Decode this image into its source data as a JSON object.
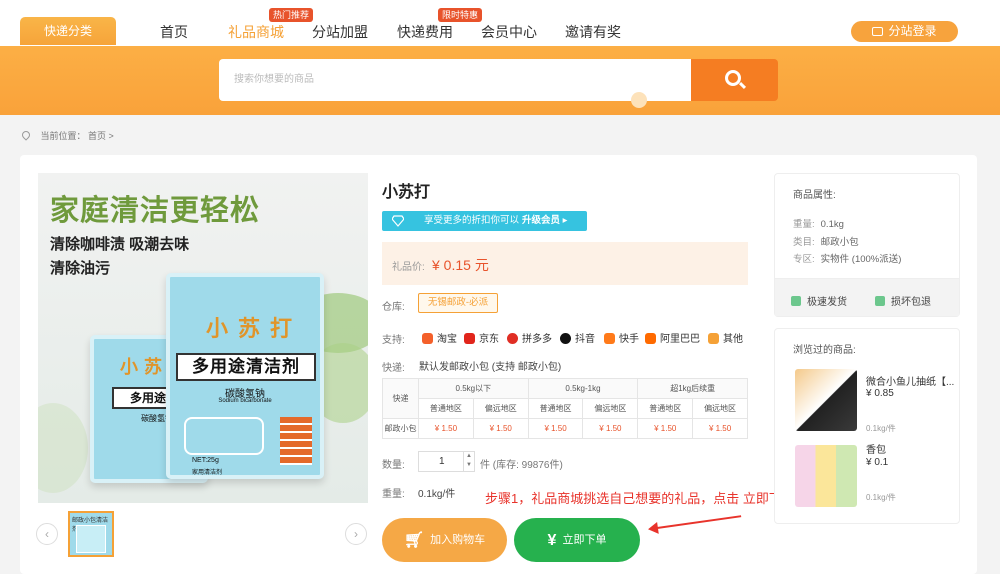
{
  "nav": {
    "category_button": "快递分类",
    "links": [
      "首页",
      "礼品商城",
      "分站加盟",
      "快递费用",
      "会员中心",
      "邀请有奖"
    ],
    "badge_hot": "热门推荐",
    "badge_sale": "限时特惠",
    "login_label": "分站登录"
  },
  "search": {
    "placeholder": "搜索你想要的商品"
  },
  "breadcrumb": {
    "label": "当前位置：",
    "path": "首页 >"
  },
  "product": {
    "title": "小苏打",
    "vip_message": "享受更多的折扣你可以",
    "vip_upgrade": "升级会员 ▸",
    "price_label": "礼品价:",
    "price": "¥ 0.15 元",
    "warehouse_label": "仓库:",
    "warehouse_value": "无锡邮政-必派",
    "support_label": "支持:",
    "platforms": [
      "淘宝",
      "京东",
      "拼多多",
      "抖音",
      "快手",
      "阿里巴巴",
      "其他"
    ],
    "shipping_label": "快递:",
    "shipping_text": "默认发邮政小包 (支持 邮政小包)",
    "table": {
      "corner": "快递",
      "groups": [
        "0.5kg以下",
        "0.5kg-1kg",
        "超1kg后续重"
      ],
      "subheads": [
        "普通地区",
        "偏远地区",
        "普通地区",
        "偏远地区",
        "普通地区",
        "偏远地区"
      ],
      "row_name": "邮政小包",
      "row_values": [
        "¥ 1.50",
        "¥ 1.50",
        "¥ 1.50",
        "¥ 1.50",
        "¥ 1.50",
        "¥ 1.50"
      ]
    },
    "qty_label": "数量:",
    "qty_value": "1",
    "stock_text": "件 (库存: 99876件)",
    "weight_label": "重量:",
    "weight_value": "0.1kg/件",
    "add_cart": "加入购物车",
    "buy_now": "立即下单",
    "annotation": "步骤1，礼品商城挑选自己想要的礼品，点击 立即下单",
    "image": {
      "headline": "家庭清洁更轻松",
      "line1": "清除咖啡渍 吸潮去味",
      "line2": "清除油污",
      "pack_brand": "小苏打",
      "pack_title": "多用途清洁剂",
      "pack_sub1": "碳酸氢钠",
      "pack_sub2": "Sodium bicarbonate",
      "pack_net": "NET:25g",
      "pack_foot": "家用清洁剂",
      "pack2_title": "多用途清洁",
      "pack2_sub": "碳酸氢钠"
    },
    "thumb_label": "邮政小包清洁剂"
  },
  "attributes": {
    "title": "商品属性:",
    "rows": [
      {
        "k": "重量:",
        "v": "0.1kg"
      },
      {
        "k": "类目:",
        "v": "邮政小包"
      },
      {
        "k": "专区:",
        "v": "实物件 (100%派送)"
      }
    ],
    "guarantee1": "极速发货",
    "guarantee2": "损坏包退"
  },
  "history": {
    "title": "浏览过的商品:",
    "items": [
      {
        "name": "微合小鱼儿抽纸【...",
        "price": "¥ 0.85",
        "sold": "0.1kg/件"
      },
      {
        "name": "香包",
        "price": "¥ 0.1",
        "sold": "0.1kg/件"
      }
    ]
  },
  "colors": {
    "accent": "#f5a136",
    "price": "#e8532b",
    "buy": "#26b14e",
    "vip": "#36c3e0"
  }
}
